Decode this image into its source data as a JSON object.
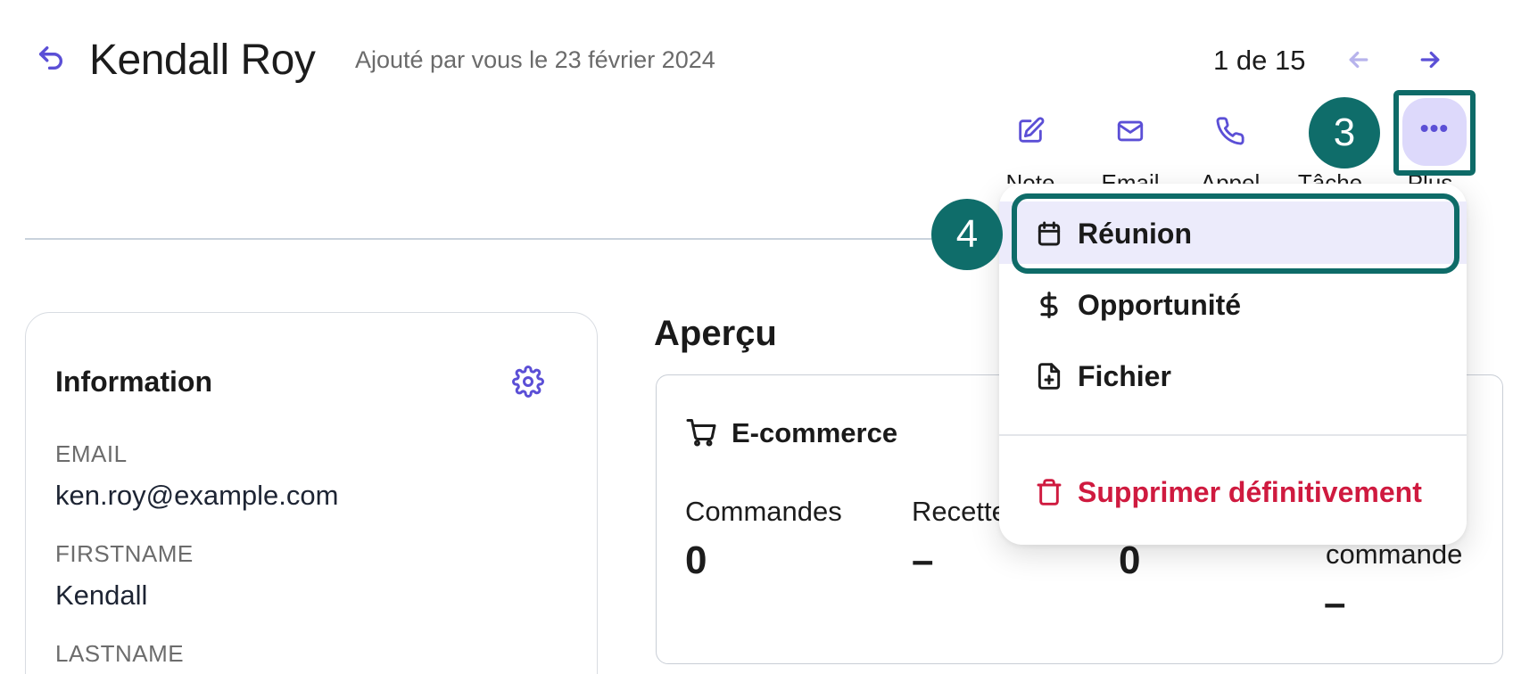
{
  "header": {
    "title": "Kendall Roy",
    "subtitle": "Ajouté par vous le 23 février 2024",
    "pager": "1 de 15"
  },
  "actions": [
    {
      "label": "Note",
      "icon": "edit-icon"
    },
    {
      "label": "Email",
      "icon": "mail-icon"
    },
    {
      "label": "Appel",
      "icon": "phone-icon"
    },
    {
      "label": "Tâche",
      "icon": "task-icon"
    },
    {
      "label": "Plus",
      "icon": "more-icon"
    }
  ],
  "annotations": {
    "step_3": "3",
    "step_4": "4",
    "highlight_color": "#0e6b68"
  },
  "more_menu": {
    "items": [
      {
        "label": "Réunion",
        "icon": "calendar-icon",
        "active": true
      },
      {
        "label": "Opportunité",
        "icon": "dollar-icon"
      },
      {
        "label": "Fichier",
        "icon": "file-add-icon"
      },
      {
        "label": "Supprimer définitivement",
        "icon": "trash-icon",
        "danger": true
      }
    ]
  },
  "information": {
    "title": "Information",
    "fields": [
      {
        "label": "EMAIL",
        "value": "ken.roy@example.com"
      },
      {
        "label": "FIRSTNAME",
        "value": "Kendall"
      },
      {
        "label": "LASTNAME",
        "value": ""
      }
    ]
  },
  "overview": {
    "title": "Aperçu",
    "ecommerce": {
      "title": "E-commerce",
      "metrics": [
        {
          "label": "Commandes",
          "value": "0"
        },
        {
          "label": "Recettes",
          "value": "–"
        },
        {
          "label": "",
          "value": "0"
        },
        {
          "label": "commande",
          "value": "–"
        }
      ]
    }
  },
  "colors": {
    "accent": "#5b4fd6",
    "accent_soft": "#ddd9fb",
    "danger": "#cf1a3f"
  }
}
